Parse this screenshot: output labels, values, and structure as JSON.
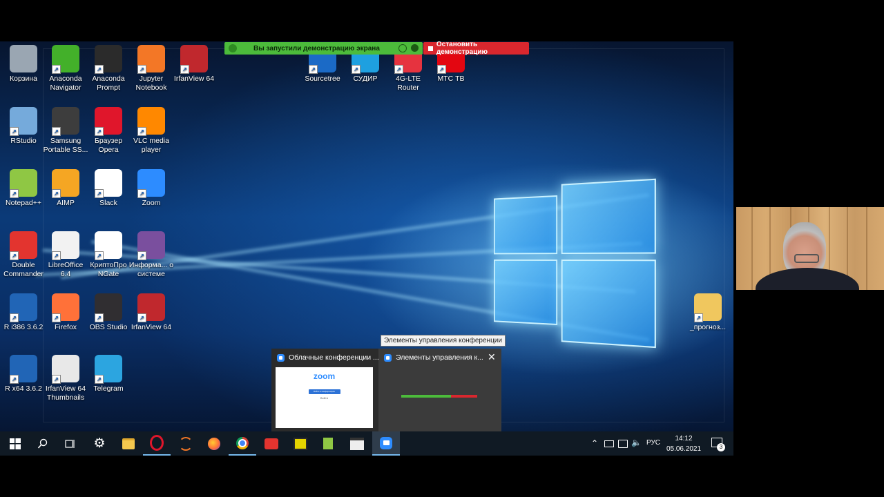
{
  "share_banner": {
    "text": "Вы запустили демонстрацию экрана",
    "stop_label": "Остановить демонстрацию"
  },
  "desktop_icons": [
    {
      "label": "Корзина",
      "icon": "recycle-bin-icon",
      "color": "#9aa6b2"
    },
    {
      "label": "Anaconda Navigator",
      "icon": "anaconda-icon",
      "color": "#43b02a"
    },
    {
      "label": "Anaconda Prompt",
      "icon": "terminal-icon",
      "color": "#2b2b2b"
    },
    {
      "label": "Jupyter Notebook",
      "icon": "jupyter-icon",
      "color": "#f37726"
    },
    {
      "label": "IrfanView 64",
      "icon": "irfanview-icon",
      "color": "#c0282d"
    },
    {
      "label": "Sourcetree",
      "icon": "sourcetree-icon",
      "color": "#1b6ac6"
    },
    {
      "label": "СУДИР",
      "icon": "ie-icon",
      "color": "#1ea0e0"
    },
    {
      "label": "4G-LTE Router",
      "icon": "router-icon",
      "color": "#e6333f"
    },
    {
      "label": "МТС ТВ",
      "icon": "mts-tv-icon",
      "color": "#e30611"
    },
    {
      "label": "RStudio",
      "icon": "rstudio-icon",
      "color": "#75aadb"
    },
    {
      "label": "Samsung Portable SS...",
      "icon": "samsung-ssd-icon",
      "color": "#3d3d3d"
    },
    {
      "label": "Браузер Opera",
      "icon": "opera-icon",
      "color": "#e0162b"
    },
    {
      "label": "VLC media player",
      "icon": "vlc-icon",
      "color": "#ff8800"
    },
    {
      "label": "Notepad++",
      "icon": "notepadpp-icon",
      "color": "#8fc744"
    },
    {
      "label": "AIMP",
      "icon": "aimp-icon",
      "color": "#f5a623"
    },
    {
      "label": "Slack",
      "icon": "slack-icon",
      "color": "#ffffff"
    },
    {
      "label": "Zoom",
      "icon": "zoom-icon",
      "color": "#2d8cff"
    },
    {
      "label": "Double Commander",
      "icon": "double-commander-icon",
      "color": "#e3342f"
    },
    {
      "label": "LibreOffice 6.4",
      "icon": "libreoffice-icon",
      "color": "#f2f2f2"
    },
    {
      "label": "КриптоПро NGate",
      "icon": "cryptopro-icon",
      "color": "#ffffff"
    },
    {
      "label": "Информа... о системе",
      "icon": "system-info-icon",
      "color": "#7a4f9e"
    },
    {
      "label": "R i386 3.6.2",
      "icon": "r-icon",
      "color": "#2165b6"
    },
    {
      "label": "Firefox",
      "icon": "firefox-icon",
      "color": "#ff7139"
    },
    {
      "label": "OBS Studio",
      "icon": "obs-icon",
      "color": "#302e31"
    },
    {
      "label": "IrfanView 64",
      "icon": "irfanview-icon",
      "color": "#c0282d"
    },
    {
      "label": "R x64 3.6.2",
      "icon": "r-icon",
      "color": "#2165b6"
    },
    {
      "label": "IrfanView 64 Thumbnails",
      "icon": "panda-icon",
      "color": "#e8e8e8"
    },
    {
      "label": "Telegram",
      "icon": "telegram-icon",
      "color": "#2ca5e0"
    },
    {
      "label": "_прогноз...",
      "icon": "folder-icon",
      "color": "#f0c75e"
    }
  ],
  "tooltip": "Элементы управления конференции",
  "thumbnails": [
    {
      "title": "Облачные конференции ...",
      "brand": "zoom",
      "button": "Войти в конференцию",
      "link": "Войти"
    },
    {
      "title": "Элементы управления к..."
    }
  ],
  "tray": {
    "lang": "РУС",
    "time": "14:12",
    "date": "05.06.2021",
    "notifications": "3"
  }
}
